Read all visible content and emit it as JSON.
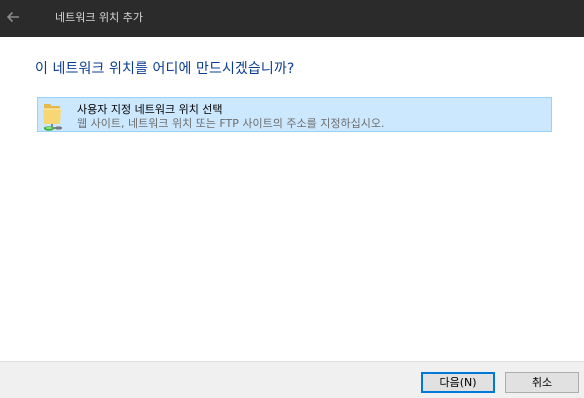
{
  "window": {
    "title": "네트워크 위치 추가"
  },
  "icons": {
    "back": "back-arrow-icon",
    "option": "network-folder-icon"
  },
  "main": {
    "heading": "이 네트워크 위치를 어디에 만드시겠습니까?"
  },
  "options": [
    {
      "title": "사용자 지정 네트워크 위치 선택",
      "description": "웹 사이트, 네트워크 위치 또는 FTP 사이트의 주소를 지정하십시오.",
      "selected": true
    }
  ],
  "footer": {
    "next_label": "다음(N)",
    "cancel_label": "취소"
  },
  "colors": {
    "titlebar": "#2b2b2b",
    "heading": "#0b3d91",
    "selection": "#cce8ff",
    "accent": "#0078d7"
  }
}
